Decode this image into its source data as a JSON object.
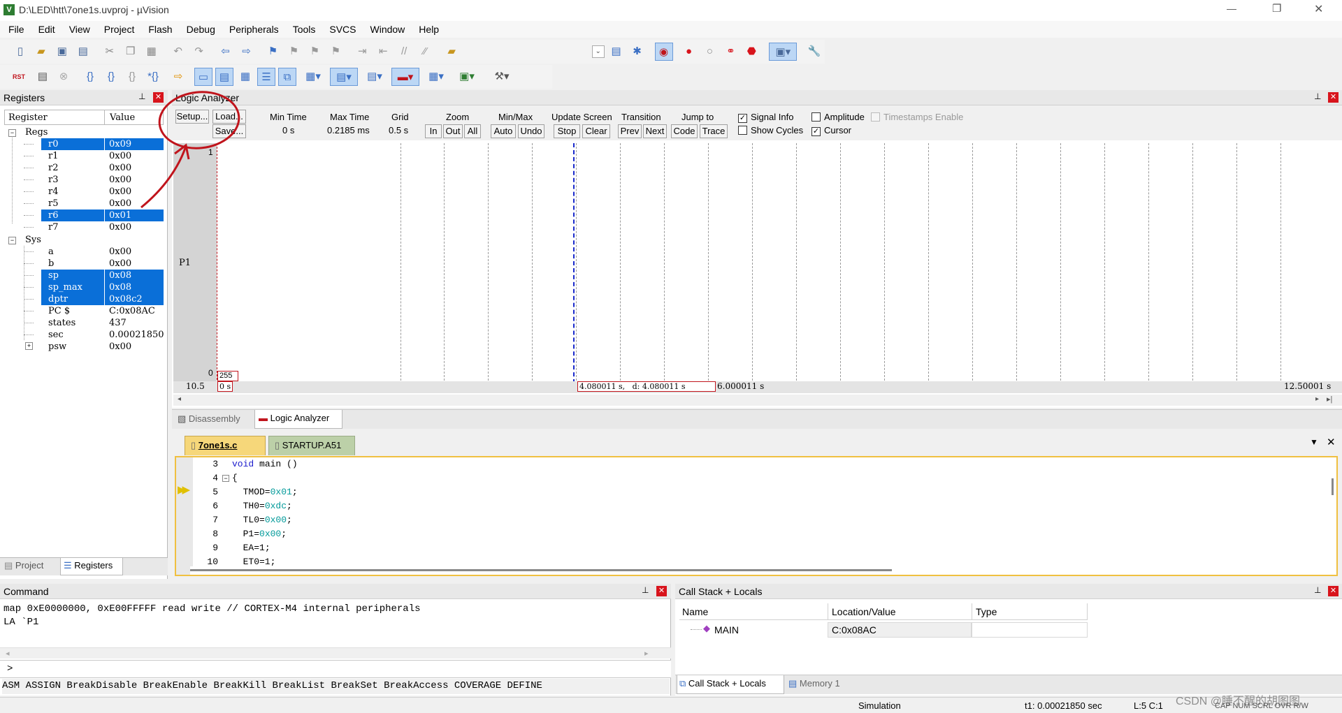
{
  "window": {
    "title": "D:\\LED\\htt\\7one1s.uvproj - µVision",
    "controls": [
      "—",
      "❐",
      "✕"
    ]
  },
  "menu": [
    "File",
    "Edit",
    "View",
    "Project",
    "Flash",
    "Debug",
    "Peripherals",
    "Tools",
    "SVCS",
    "Window",
    "Help"
  ],
  "toolbar1": [
    "new-file",
    "open-file",
    "save",
    "save-all",
    "cut",
    "copy",
    "paste",
    "undo",
    "redo",
    "back",
    "forward",
    "bookmark",
    "prev-bookmark",
    "next-bookmark",
    "clear-bookmarks",
    "indent",
    "unindent",
    "comment",
    "uncomment",
    "find-in-files",
    "",
    "dropdown",
    "find",
    "debug-session",
    "insert-breakpoint",
    "disable-breakpoint",
    "disable-all-breakpoints",
    "kill-breakpoints",
    "window-layout",
    "configure"
  ],
  "toolbar2": [
    "reset",
    "run",
    "stop",
    "step-into",
    "step-over",
    "step-out",
    "run-to-cursor",
    "show-next",
    "command-window",
    "disassembly-window",
    "symbols-window",
    "registers-window",
    "call-stack",
    "watch-window",
    "memory-window",
    "serial-window",
    "analysis-window",
    "trace-window",
    "system-viewer",
    "toolbox"
  ],
  "registers": {
    "title": "Registers",
    "col_register": "Register",
    "col_value": "Value",
    "group_regs": "Regs",
    "group_sys": "Sys",
    "regs": [
      {
        "name": "r0",
        "value": "0x09",
        "hl": true
      },
      {
        "name": "r1",
        "value": "0x00",
        "hl": false
      },
      {
        "name": "r2",
        "value": "0x00",
        "hl": false
      },
      {
        "name": "r3",
        "value": "0x00",
        "hl": false
      },
      {
        "name": "r4",
        "value": "0x00",
        "hl": false
      },
      {
        "name": "r5",
        "value": "0x00",
        "hl": false
      },
      {
        "name": "r6",
        "value": "0x01",
        "hl": true
      },
      {
        "name": "r7",
        "value": "0x00",
        "hl": false
      }
    ],
    "sys": [
      {
        "name": "a",
        "value": "0x00",
        "hl": false
      },
      {
        "name": "b",
        "value": "0x00",
        "hl": false
      },
      {
        "name": "sp",
        "value": "0x08",
        "hl": true
      },
      {
        "name": "sp_max",
        "value": "0x08",
        "hl": true
      },
      {
        "name": "dptr",
        "value": "0x08c2",
        "hl": true
      },
      {
        "name": "PC  $",
        "value": "C:0x08AC",
        "hl": false
      },
      {
        "name": "states",
        "value": "437",
        "hl": false
      },
      {
        "name": "sec",
        "value": "0.00021850",
        "hl": false
      },
      {
        "name": "psw",
        "value": "0x00",
        "hl": false
      }
    ],
    "tabs": [
      "Project",
      "Registers"
    ]
  },
  "logic_analyzer": {
    "title": "Logic Analyzer",
    "setup": "Setup...",
    "load": "Load...",
    "save": "Save...",
    "min_time_label": "Min Time",
    "min_time": "0 s",
    "max_time_label": "Max Time",
    "max_time": "0.2185 ms",
    "grid_label": "Grid",
    "grid": "0.5 s",
    "zoom_label": "Zoom",
    "zoom_in": "In",
    "zoom_out": "Out",
    "zoom_all": "All",
    "minmax_label": "Min/Max",
    "auto": "Auto",
    "undo": "Undo",
    "update_label": "Update Screen",
    "stop": "Stop",
    "clear": "Clear",
    "transition_label": "Transition",
    "prev": "Prev",
    "next": "Next",
    "jump_label": "Jump to",
    "code": "Code",
    "trace": "Trace",
    "signal_info": "Signal Info",
    "show_cycles": "Show Cycles",
    "amplitude": "Amplitude",
    "cursor": "Cursor",
    "timestamps": "Timestamps Enable",
    "y_top": "1",
    "y_bottom": "0",
    "signal": "P1",
    "value_box": "255",
    "left_time": "10.5",
    "start_time": "0 s",
    "cursor_time": "4.080011 s,   d: 4.080011 s",
    "mid_time": "6.000011 s",
    "end_time": "12.50001 s"
  },
  "view_tabs": [
    "Disassembly",
    "Logic Analyzer"
  ],
  "editor": {
    "tabs": [
      "7one1s.c",
      "STARTUP.A51"
    ],
    "lines": [
      {
        "n": "3",
        "kw": "void",
        "rest": " main ()",
        "num": ""
      },
      {
        "n": "4",
        "kw": "",
        "rest": "{",
        "num": ""
      },
      {
        "n": "5",
        "kw": "",
        "rest": "  TMOD=",
        "num": "0x01"
      },
      {
        "n": "6",
        "kw": "",
        "rest": "  TH0=",
        "num": "0xdc"
      },
      {
        "n": "7",
        "kw": "",
        "rest": "  TL0=",
        "num": "0x00"
      },
      {
        "n": "8",
        "kw": "",
        "rest": "  P1=",
        "num": "0x00"
      },
      {
        "n": "9",
        "kw": "",
        "rest": "  EA=",
        "num": "1"
      },
      {
        "n": "10",
        "kw": "",
        "rest": "  ET0=1;",
        "num": ""
      }
    ]
  },
  "command": {
    "title": "Command",
    "output": [
      "map 0xE0000000, 0xE00FFFFF read write // CORTEX-M4 internal peripherals",
      "LA `P1"
    ],
    "prompt": ">",
    "keywords": "ASM ASSIGN BreakDisable BreakEnable BreakKill BreakList BreakSet BreakAccess COVERAGE DEFINE"
  },
  "callstack": {
    "title": "Call Stack + Locals",
    "col_name": "Name",
    "col_location": "Location/Value",
    "col_type": "Type",
    "row": {
      "name": "MAIN",
      "location": "C:0x08AC",
      "type": ""
    },
    "tabs": [
      "Call Stack + Locals",
      "Memory 1"
    ]
  },
  "status": {
    "mode": "Simulation",
    "t1": "t1: 0.00021850 sec",
    "pos": "L:5 C:1",
    "caps": "CAP NUM SCRL OVR R/W"
  },
  "watermark": "CSDN @睡不醒的胡图图",
  "colors": {
    "selection": "#0a6fd8",
    "keyword": "#1a1acc",
    "number": "#009999",
    "annotation": "#c0141c"
  }
}
